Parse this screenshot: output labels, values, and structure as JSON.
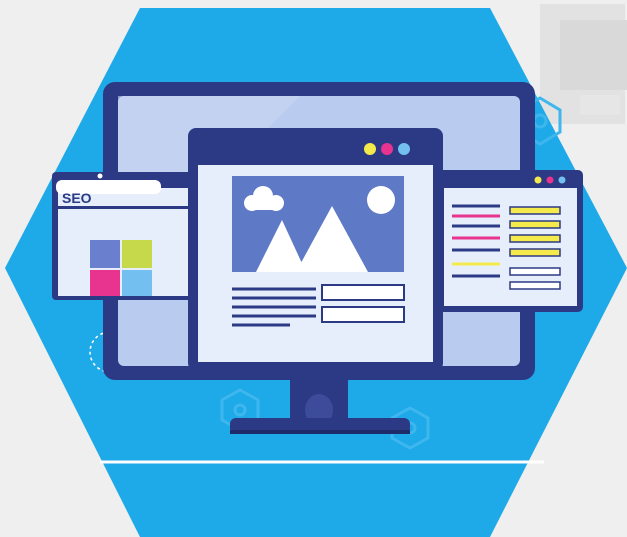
{
  "illustration": {
    "seo_label": "SEO"
  },
  "colors": {
    "page_bg": "#efefef",
    "hexagon": "#1ea9e8",
    "monitor_frame": "#2c3a85",
    "screen": "#b9cbee",
    "window_bg": "#e6eefb",
    "image_panel": "#5e79c6",
    "accent_yellow": "#f4ea4b",
    "accent_pink": "#e8338f",
    "accent_green": "#c5d94a",
    "accent_light_blue": "#73bff0"
  },
  "icons": [
    "gear-icon",
    "image-icon",
    "cloud-icon",
    "sun-icon",
    "mountain-icon"
  ]
}
